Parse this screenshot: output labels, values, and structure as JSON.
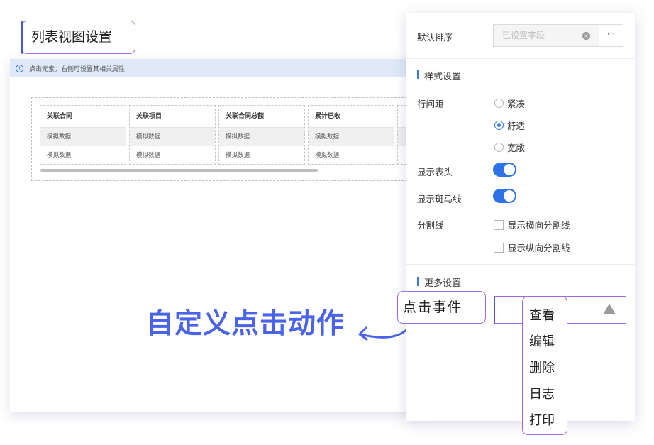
{
  "title_badge": "列表视图设置",
  "info_bar": {
    "text": "点击元素，右侧可设置其相关属性"
  },
  "table": {
    "columns": [
      "关联合同",
      "关联项目",
      "关联合同总额",
      "累计已收"
    ],
    "rows": [
      [
        "模拟数据",
        "模拟数据",
        "模拟数据",
        "模拟数据"
      ],
      [
        "模拟数据",
        "模拟数据",
        "模拟数据",
        "模拟数据"
      ]
    ]
  },
  "headline": "自定义点击动作",
  "panel": {
    "sort_label": "默认排序",
    "sort_value": "已设置字段",
    "more_button": "···",
    "style_section": "样式设置",
    "line_spacing_label": "行间距",
    "line_spacing_options": [
      "紧凑",
      "舒适",
      "宽敞"
    ],
    "line_spacing_selected": "舒适",
    "show_header_label": "显示表头",
    "show_header_on": true,
    "show_stripe_label": "显示斑马线",
    "show_stripe_on": true,
    "divider_label": "分割线",
    "divider_options": [
      "显示横向分割线",
      "显示纵向分割线"
    ],
    "more_section": "更多设置",
    "event_label": "点击事件",
    "event_options": [
      "查看",
      "编辑",
      "删除",
      "日志",
      "打印"
    ]
  },
  "colors": {
    "accent": "#3b7be0",
    "headline": "#4b63e8",
    "badge_border": "#a06ae0",
    "toggle": "#2e72e8"
  }
}
